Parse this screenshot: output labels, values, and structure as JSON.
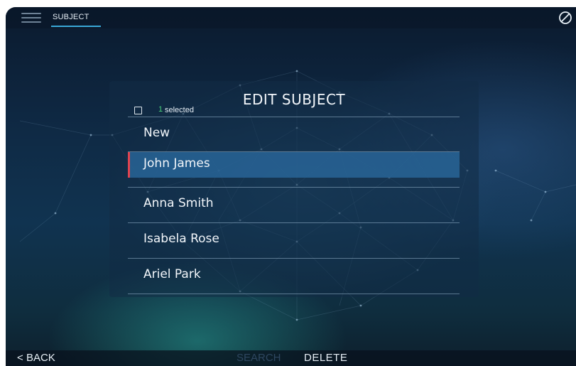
{
  "topbar": {
    "menu_icon": "hamburger-menu-icon",
    "tab_label": "SUBJECT",
    "cancel_icon": "prohibited-circle-icon"
  },
  "panel": {
    "title": "EDIT SUBJECT",
    "selected_count": "1",
    "selected_text": "selected",
    "items": [
      {
        "label": "New",
        "selected": false
      },
      {
        "label": "John James",
        "selected": true
      },
      {
        "label": "Anna Smith",
        "selected": false
      },
      {
        "label": "Isabela Rose",
        "selected": false
      },
      {
        "label": "Ariel Park",
        "selected": false
      }
    ]
  },
  "bottombar": {
    "back_label": "BACK",
    "search_label": "SEARCH",
    "delete_label": "DELETE"
  },
  "colors": {
    "accent": "#3aa8d8",
    "selected_marker": "#e0434f",
    "selected_count": "#49d17a",
    "selected_row": "#28649a"
  }
}
